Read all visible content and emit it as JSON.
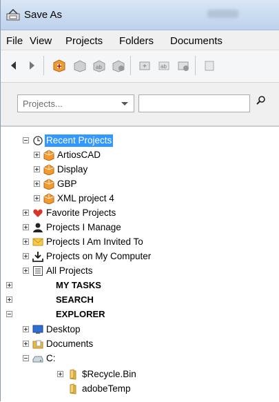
{
  "window": {
    "title": "Save As"
  },
  "menu": [
    "File",
    "View",
    "Projects",
    "Folders",
    "Documents"
  ],
  "filter": {
    "combo_placeholder": "Projects...",
    "search_value": ""
  },
  "tree": {
    "recent_projects": "Recent Projects",
    "artioscad": "ArtiosCAD",
    "display": "Display",
    "gbp": "GBP",
    "xml_project": "XML project 4",
    "favorite_projects": "Favorite Projects",
    "projects_i_manage": "Projects I Manage",
    "projects_invited": "Projects I Am Invited To",
    "projects_on_computer": "Projects on My Computer",
    "all_projects": "All Projects",
    "my_tasks": "MY TASKS",
    "search": "SEARCH",
    "explorer": "EXPLORER",
    "desktop": "Desktop",
    "documents": "Documents",
    "c_drive": "C:",
    "recycle_bin": "$Recycle.Bin",
    "adobe_temp": "adobeTemp"
  },
  "colors": {
    "selection": "#3399ff",
    "folder": "#e8b84a",
    "project": "#f29a2e"
  }
}
